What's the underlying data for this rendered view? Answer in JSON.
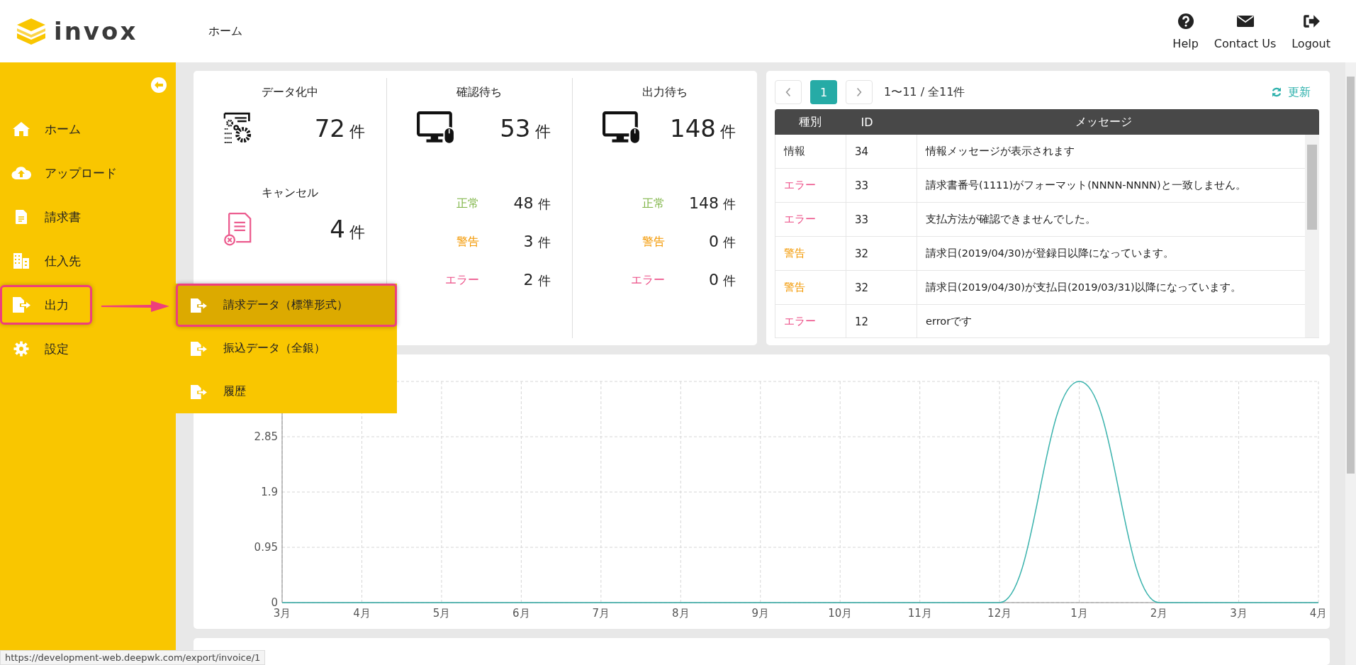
{
  "header": {
    "logo": "invox",
    "breadcrumb": "ホーム",
    "actions": [
      {
        "kind": "help",
        "label": "Help"
      },
      {
        "kind": "contact",
        "label": "Contact Us"
      },
      {
        "kind": "logout",
        "label": "Logout"
      }
    ]
  },
  "sidebar": {
    "items": [
      {
        "kind": "home",
        "label": "ホーム",
        "highlighted": false
      },
      {
        "kind": "upload",
        "label": "アップロード",
        "highlighted": false
      },
      {
        "kind": "invoice",
        "label": "請求書",
        "highlighted": false
      },
      {
        "kind": "supplier",
        "label": "仕入先",
        "highlighted": false
      },
      {
        "kind": "export",
        "label": "出力",
        "highlighted": true
      },
      {
        "kind": "settings",
        "label": "設定",
        "highlighted": false
      }
    ]
  },
  "submenu": {
    "items": [
      {
        "label": "請求データ（標準形式）",
        "selected": true
      },
      {
        "label": "振込データ（全銀）",
        "selected": false
      },
      {
        "label": "履歴",
        "selected": false
      }
    ]
  },
  "stats": {
    "columns": [
      {
        "blocks": [
          {
            "kind": "processing",
            "title": "データ化中",
            "count": "72",
            "unit": "件"
          },
          {
            "kind": "cancel",
            "title": "キャンセル",
            "count": "4",
            "unit": "件"
          }
        ]
      },
      {
        "blocks": [
          {
            "kind": "monitor",
            "title": "確認待ち",
            "count": "53",
            "unit": "件",
            "breakdown": [
              {
                "kind": "ok",
                "label": "正常",
                "count": "48",
                "unit": "件"
              },
              {
                "kind": "warning",
                "label": "警告",
                "count": "3",
                "unit": "件"
              },
              {
                "kind": "error",
                "label": "エラー",
                "count": "2",
                "unit": "件"
              }
            ]
          }
        ]
      },
      {
        "blocks": [
          {
            "kind": "monitor",
            "title": "出力待ち",
            "count": "148",
            "unit": "件",
            "breakdown": [
              {
                "kind": "ok",
                "label": "正常",
                "count": "148",
                "unit": "件"
              },
              {
                "kind": "warning",
                "label": "警告",
                "count": "0",
                "unit": "件"
              },
              {
                "kind": "error",
                "label": "エラー",
                "count": "0",
                "unit": "件"
              }
            ]
          }
        ]
      }
    ]
  },
  "messages": {
    "pagination": {
      "pages": [
        {
          "label": "1",
          "selected": true
        }
      ],
      "range": "1〜11 / 全11件"
    },
    "refresh": "更新",
    "table": {
      "columns": [
        "種別",
        "ID",
        "メッセージ"
      ],
      "rows": [
        {
          "kind": "info",
          "type": "情報",
          "id": "34",
          "message": "情報メッセージが表示されます"
        },
        {
          "kind": "error",
          "type": "エラー",
          "id": "33",
          "message": "請求書番号(1111)がフォーマット(NNNN-NNNN)と一致しません。"
        },
        {
          "kind": "error",
          "type": "エラー",
          "id": "33",
          "message": "支払方法が確認できませんでした。"
        },
        {
          "kind": "warning",
          "type": "警告",
          "id": "32",
          "message": "請求日(2019/04/30)が登録日以降になっています。"
        },
        {
          "kind": "warning",
          "type": "警告",
          "id": "32",
          "message": "請求日(2019/04/30)が支払日(2019/03/31)以降になっています。"
        },
        {
          "kind": "error",
          "type": "エラー",
          "id": "12",
          "message": "errorです"
        }
      ]
    }
  },
  "chart": {
    "chart_data": {
      "type": "line",
      "categories": [
        "3月",
        "4月",
        "5月",
        "6月",
        "7月",
        "8月",
        "9月",
        "10月",
        "11月",
        "12月",
        "1月",
        "2月",
        "3月",
        "4月"
      ],
      "grid": true,
      "series": [
        {
          "color": "#3bb3ad",
          "values": [
            0,
            0,
            0,
            0,
            0,
            0,
            0,
            0,
            0,
            0,
            3.8,
            0,
            0,
            0
          ]
        }
      ],
      "ylim": [
        0,
        3.8
      ],
      "yticks": [
        0,
        0.95,
        1.9,
        2.85
      ]
    }
  },
  "status_url": "https://development-web.deepwk.com/export/invoice/1"
}
